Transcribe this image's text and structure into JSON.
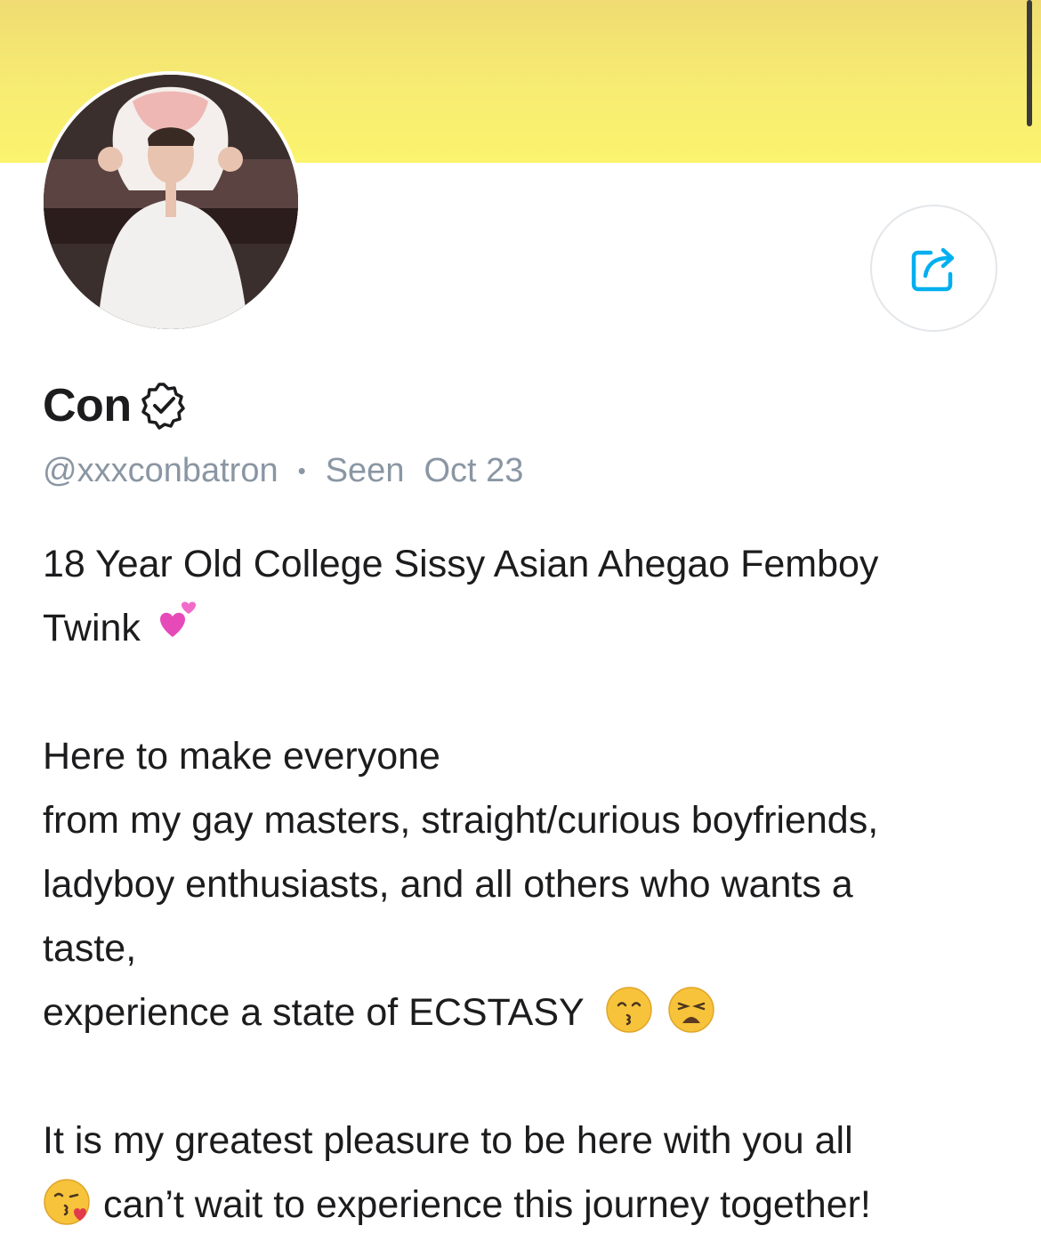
{
  "profile": {
    "name": "Con",
    "handle": "@xxxconbatron",
    "separator": "•",
    "seen_label": "Seen",
    "seen_date": "Oct 23",
    "verified": true
  },
  "bio": {
    "line1": "18 Year Old College Sissy Asian Ahegao Femboy",
    "line2": "Twink",
    "line3": "Here to make everyone",
    "line4": "from my gay masters, straight/curious boyfriends,",
    "line5": "ladyboy enthusiasts, and all others who wants a",
    "line6": "taste,",
    "line7": "experience a state of ECSTASY",
    "line8": "It is my greatest pleasure to be here with you all",
    "line9": "can’t wait to experience this journey together!"
  },
  "icons": {
    "share": "share-icon",
    "verified": "verified-badge-icon",
    "hearts": "two-hearts-emoji",
    "kissing": "kissing-face-emoji",
    "weary": "weary-face-emoji",
    "blowing_kiss": "face-blowing-kiss-emoji"
  },
  "colors": {
    "cover_top": "#f0dc72",
    "cover_bottom": "#fbf46e",
    "accent": "#00aff0",
    "meta_text": "#8a96a3"
  }
}
